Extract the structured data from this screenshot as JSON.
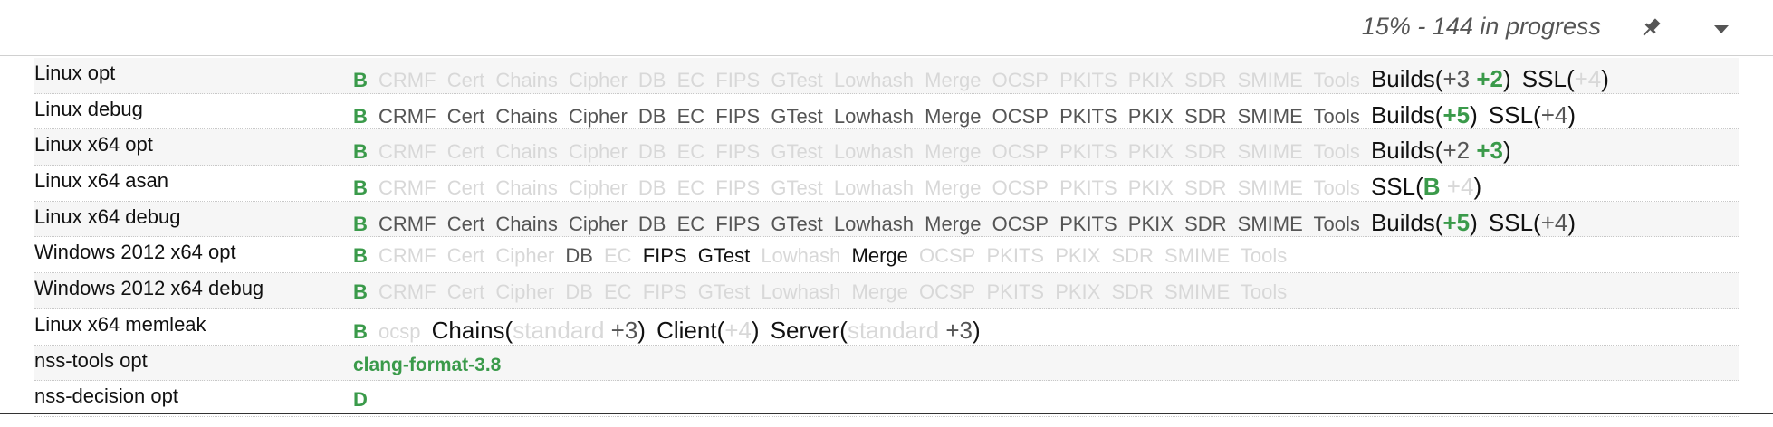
{
  "header": {
    "progress_text": "15% - 144 in progress"
  },
  "rows": [
    {
      "platform": "Linux opt"
    },
    {
      "platform": "Linux debug"
    },
    {
      "platform": "Linux x64 opt"
    },
    {
      "platform": "Linux x64 asan"
    },
    {
      "platform": "Linux x64 debug"
    },
    {
      "platform": "Windows 2012 x64 opt"
    },
    {
      "platform": "Windows 2012 x64 debug"
    },
    {
      "platform": "Linux x64 memleak"
    },
    {
      "platform": "nss-tools opt"
    },
    {
      "platform": "nss-decision opt"
    }
  ],
  "jobs": {
    "B": "B",
    "CRMF": "CRMF",
    "Cert": "Cert",
    "Chains": "Chains",
    "Cipher": "Cipher",
    "DB": "DB",
    "EC": "EC",
    "FIPS": "FIPS",
    "GTest": "GTest",
    "Lowhash": "Lowhash",
    "Merge": "Merge",
    "OCSP": "OCSP",
    "PKITS": "PKITS",
    "PKIX": "PKIX",
    "SDR": "SDR",
    "SMIME": "SMIME",
    "Tools": "Tools",
    "ocsp": "ocsp",
    "standard": "standard",
    "clang": "clang-format-3.8",
    "D": "D"
  },
  "groups": {
    "builds_open": "Builds(",
    "ssl_open": "SSL(",
    "chains_open": "Chains(",
    "client_open": "Client(",
    "server_open": "Server(",
    "close": ")"
  },
  "counts": {
    "p2": "+2",
    "p3": "+3",
    "p4": "+4",
    "p5": "+5"
  },
  "colors": {
    "green": "#3a9a4a",
    "light": "#d8d8d8",
    "text": "#555555"
  }
}
